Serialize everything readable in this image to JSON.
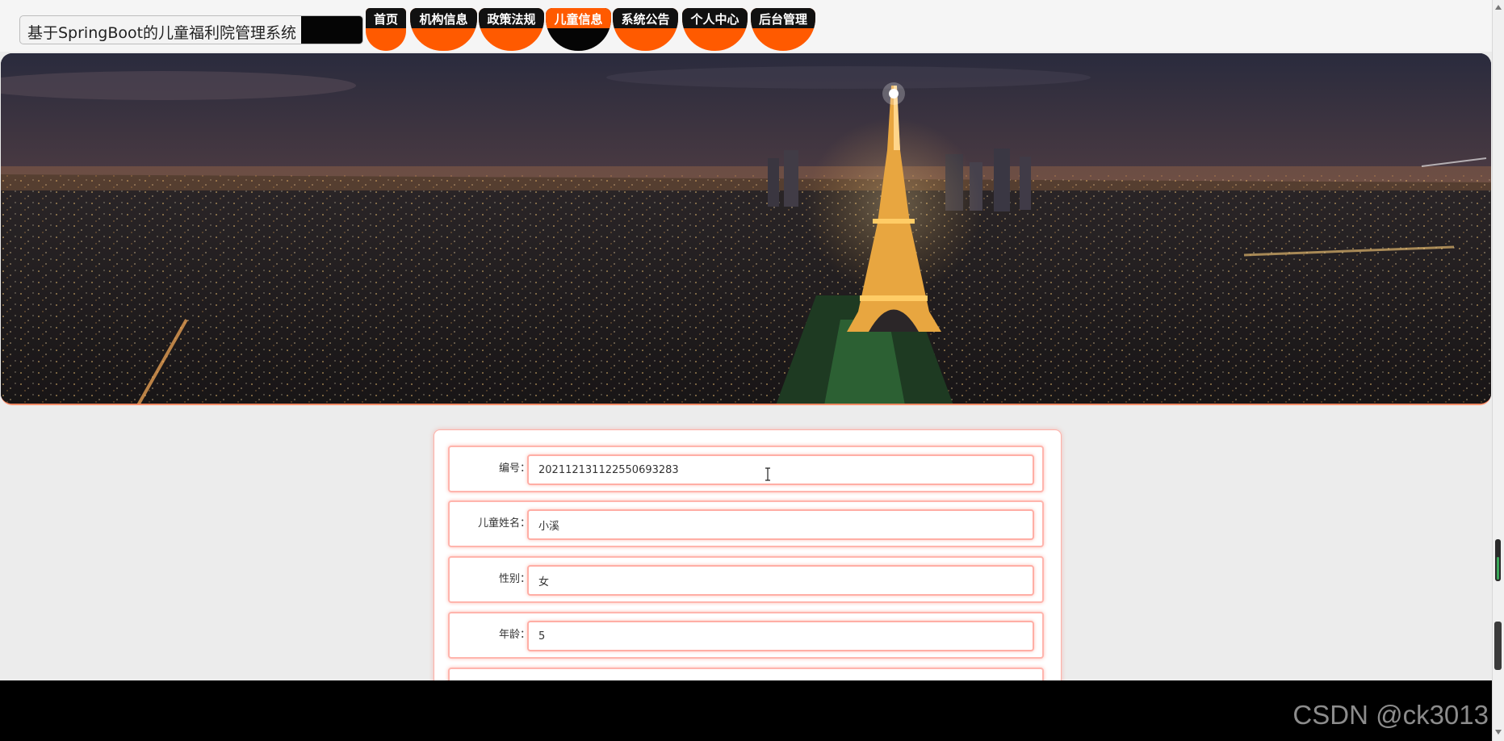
{
  "header": {
    "site_title": "基于SpringBoot的儿童福利院管理系统"
  },
  "nav": {
    "items": [
      {
        "label": "首页"
      },
      {
        "label": "机构信息"
      },
      {
        "label": "政策法规"
      },
      {
        "label": "儿童信息",
        "active": true
      },
      {
        "label": "系统公告"
      },
      {
        "label": "个人中心"
      },
      {
        "label": "后台管理"
      }
    ]
  },
  "banner": {
    "slides_count": 3,
    "active_slide": 1
  },
  "form": {
    "fields": [
      {
        "label": "编号：",
        "value": "202112131122550693283"
      },
      {
        "label": "儿童姓名：",
        "value": "小溪"
      },
      {
        "label": "性别：",
        "value": "女"
      },
      {
        "label": "年龄：",
        "value": "5"
      }
    ]
  },
  "watermark": "CSDN @ck3013",
  "colors": {
    "accent": "#ff5a00",
    "nav_dark": "#111111",
    "active_dot": "#e81010",
    "field_border": "#ffaea5"
  }
}
